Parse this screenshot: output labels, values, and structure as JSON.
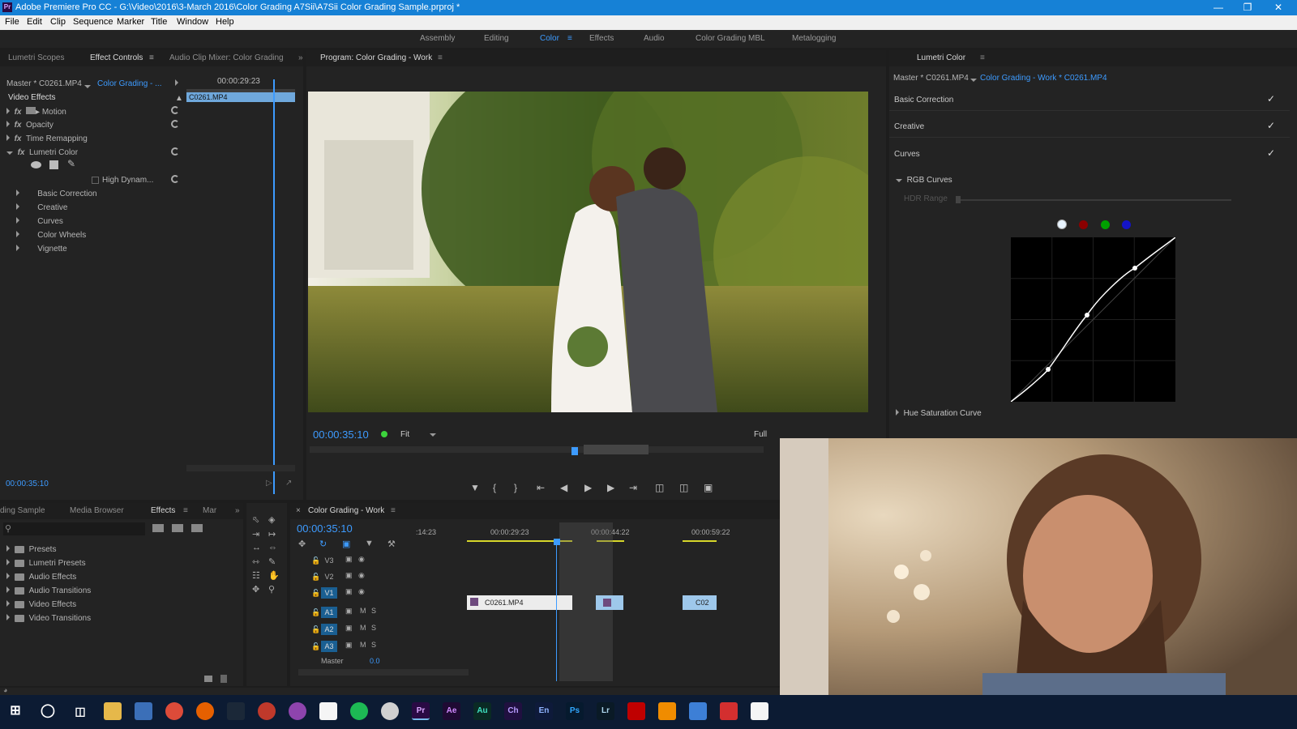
{
  "window": {
    "title": "Adobe Premiere Pro CC - G:\\Video\\2016\\3-March 2016\\Color Grading A7Sii\\A7Sii Color Grading Sample.prproj *",
    "app_icon": "Pr"
  },
  "menu": [
    "File",
    "Edit",
    "Clip",
    "Sequence",
    "Marker",
    "Title",
    "Window",
    "Help"
  ],
  "workspaces": {
    "items": [
      "Assembly",
      "Editing",
      "Color",
      "Effects",
      "Audio",
      "Color Grading MBL",
      "Metalogging"
    ],
    "active": "Color"
  },
  "effect_controls": {
    "tabs": [
      "Lumetri Scopes",
      "Effect Controls",
      "Audio Clip Mixer: Color Grading"
    ],
    "active_tab": "Effect Controls",
    "master": "Master * C0261.MP4",
    "sequence": "Color Grading - ...",
    "timecode_top": "00:00:29:23",
    "clip": "C0261.MP4",
    "section": "Video Effects",
    "effects": [
      "Motion",
      "Opacity",
      "Time Remapping",
      "Lumetri Color"
    ],
    "hdr": "High Dynam...",
    "sub_sections": [
      "Basic Correction",
      "Creative",
      "Curves",
      "Color Wheels",
      "Vignette"
    ],
    "timecode_bottom": "00:00:35:10"
  },
  "program": {
    "title": "Program: Color Grading - Work",
    "timecode": "00:00:35:10",
    "fit": "Fit",
    "quality": "Full"
  },
  "lumetri": {
    "title": "Lumetri Color",
    "master": "Master * C0261.MP4",
    "sequence": "Color Grading - Work * C0261.MP4",
    "sections": [
      "Basic Correction",
      "Creative",
      "Curves"
    ],
    "rgb_curves": "RGB Curves",
    "hdr_range": "HDR Range",
    "channels": [
      "#e8f4ff",
      "#8b0000",
      "#00a000",
      "#1414c8"
    ],
    "hue_sat": "Hue Saturation Curve"
  },
  "project": {
    "tabs": [
      "ding Sample",
      "Media Browser",
      "Effects",
      "Mar"
    ],
    "active_tab": "Effects",
    "items": [
      "Presets",
      "Lumetri Presets",
      "Audio Effects",
      "Audio Transitions",
      "Video Effects",
      "Video Transitions"
    ]
  },
  "timeline": {
    "title": "Color Grading - Work",
    "timecode": "00:00:35:10",
    "ruler": [
      ":14:23",
      "00:00:29:23",
      "00:00:44:22",
      "00:00:59:22"
    ],
    "video_tracks": [
      "V3",
      "V2",
      "V1"
    ],
    "audio_tracks": [
      "A1",
      "A2",
      "A3"
    ],
    "master": "Master",
    "master_val": "0.0",
    "clips": [
      "C0261.MP4",
      "C02"
    ]
  },
  "taskbar": [
    "Pr",
    "Ae",
    "Au",
    "Ch",
    "En",
    "Ps",
    "Lr"
  ]
}
